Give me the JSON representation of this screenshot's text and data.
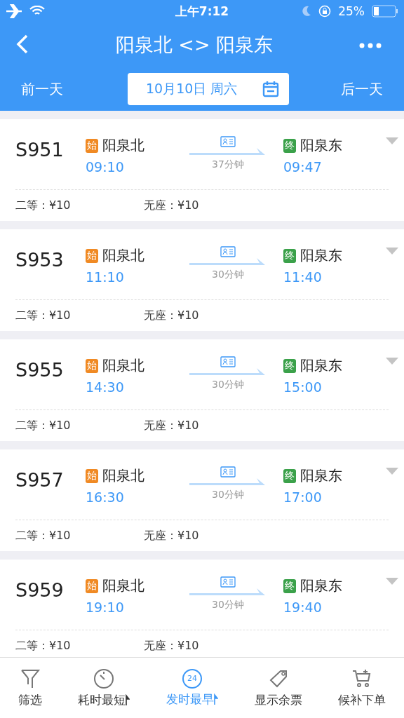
{
  "status_bar": {
    "time": "上午7:12",
    "battery": "25%"
  },
  "header": {
    "title": "阳泉北 <> 阳泉东",
    "prev_day": "前一天",
    "date": "10月10日 周六",
    "next_day": "后一天"
  },
  "trains": [
    {
      "number": "S951",
      "from_tag": "始",
      "from": "阳泉北",
      "depart": "09:10",
      "duration": "37分钟",
      "to_tag": "终",
      "to": "阳泉东",
      "arrive": "09:47",
      "seats": [
        {
          "label": "二等：¥10"
        },
        {
          "label": "无座：¥10"
        }
      ]
    },
    {
      "number": "S953",
      "from_tag": "始",
      "from": "阳泉北",
      "depart": "11:10",
      "duration": "30分钟",
      "to_tag": "终",
      "to": "阳泉东",
      "arrive": "11:40",
      "seats": [
        {
          "label": "二等：¥10"
        },
        {
          "label": "无座：¥10"
        }
      ]
    },
    {
      "number": "S955",
      "from_tag": "始",
      "from": "阳泉北",
      "depart": "14:30",
      "duration": "30分钟",
      "to_tag": "终",
      "to": "阳泉东",
      "arrive": "15:00",
      "seats": [
        {
          "label": "二等：¥10"
        },
        {
          "label": "无座：¥10"
        }
      ]
    },
    {
      "number": "S957",
      "from_tag": "始",
      "from": "阳泉北",
      "depart": "16:30",
      "duration": "30分钟",
      "to_tag": "终",
      "to": "阳泉东",
      "arrive": "17:00",
      "seats": [
        {
          "label": "二等：¥10"
        },
        {
          "label": "无座：¥10"
        }
      ]
    },
    {
      "number": "S959",
      "from_tag": "始",
      "from": "阳泉北",
      "depart": "19:10",
      "duration": "30分钟",
      "to_tag": "终",
      "to": "阳泉东",
      "arrive": "19:40",
      "seats": [
        {
          "label": "二等：¥10"
        },
        {
          "label": "无座：¥10"
        }
      ]
    }
  ],
  "bottom_bar": [
    {
      "kind": "filter",
      "label": "筛选",
      "selected": false
    },
    {
      "kind": "duration",
      "label": "耗时最短",
      "selected": false
    },
    {
      "kind": "departure",
      "label": "发时最早",
      "badge": "24",
      "selected": true
    },
    {
      "kind": "tickets",
      "label": "显示余票",
      "selected": false
    },
    {
      "kind": "waitlist",
      "label": "候补下单",
      "selected": false
    }
  ]
}
